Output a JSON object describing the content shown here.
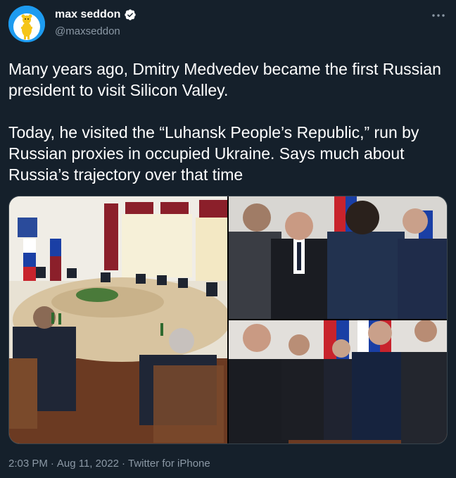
{
  "author": {
    "display_name": "max seddon",
    "handle": "@maxseddon",
    "verified": true,
    "avatar_icon": "yellow-bear-avatar"
  },
  "menu": {
    "icon": "more-horizontal-icon"
  },
  "tweet": {
    "paragraphs": [
      "Many years ago, Dmitry Medvedev became the first Russian president to visit Silicon Valley.",
      "Today, he visited the “Luhansk People’s Republic,” run by Russian proxies in occupied Ukraine. Says much about Russia’s trajectory over that time"
    ]
  },
  "media": {
    "photos": [
      {
        "alt": "Meeting around a large conference table with flags"
      },
      {
        "alt": "Men in suits standing and talking"
      },
      {
        "alt": "Group of men in suits posing in front of flags"
      }
    ]
  },
  "meta": {
    "time": "2:03 PM",
    "separator": "·",
    "date": "Aug 11, 2022",
    "source": "Twitter for iPhone"
  },
  "colors": {
    "background": "#15202b",
    "text": "#ffffff",
    "secondary_text": "#8b98a5",
    "accent": "#1d9bf0"
  }
}
